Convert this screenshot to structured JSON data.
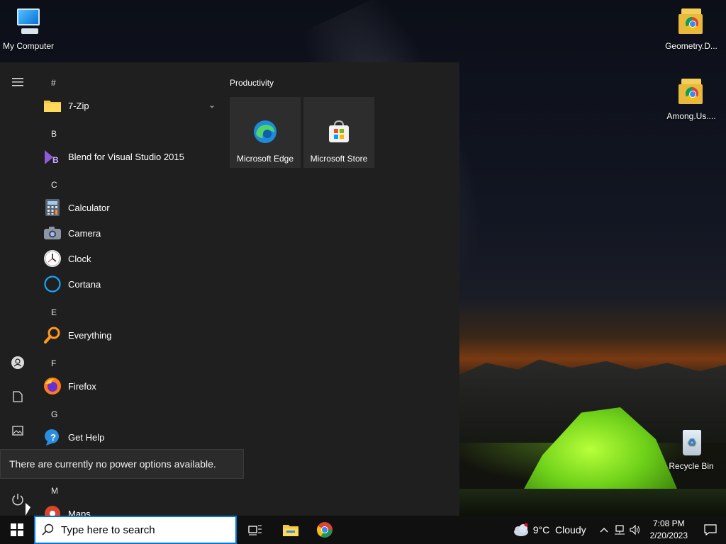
{
  "desktop": {
    "icons": [
      {
        "label": "My Computer"
      },
      {
        "label": "Geometry.D..."
      },
      {
        "label": "Among.Us...."
      },
      {
        "label": "Recycle Bin"
      }
    ]
  },
  "start_menu": {
    "groups": [
      {
        "letter": "#",
        "apps": [
          {
            "label": "7-Zip",
            "icon": "folder-icon",
            "expandable": true
          }
        ]
      },
      {
        "letter": "B",
        "apps": [
          {
            "label": "Blend for Visual Studio 2015",
            "icon": "blend-icon"
          }
        ]
      },
      {
        "letter": "C",
        "apps": [
          {
            "label": "Calculator",
            "icon": "calculator-icon"
          },
          {
            "label": "Camera",
            "icon": "camera-icon"
          },
          {
            "label": "Clock",
            "icon": "clock-icon"
          },
          {
            "label": "Cortana",
            "icon": "cortana-icon"
          }
        ]
      },
      {
        "letter": "E",
        "apps": [
          {
            "label": "Everything",
            "icon": "everything-icon"
          }
        ]
      },
      {
        "letter": "F",
        "apps": [
          {
            "label": "Firefox",
            "icon": "firefox-icon"
          }
        ]
      },
      {
        "letter": "G",
        "apps": [
          {
            "label": "Get Help",
            "icon": "get-help-icon"
          }
        ]
      },
      {
        "letter": "M",
        "apps": [
          {
            "label": "Maps",
            "icon": "maps-icon"
          }
        ]
      }
    ],
    "tiles_group_title": "Productivity",
    "tiles": [
      {
        "label": "Microsoft Edge",
        "icon": "edge-icon"
      },
      {
        "label": "Microsoft Store",
        "icon": "store-icon"
      }
    ],
    "power_tooltip": "There are currently no power options available."
  },
  "taskbar": {
    "search_placeholder": "Type here to search",
    "weather": "9°C  Cloudy",
    "time": "7:08 PM",
    "date": "2/20/2023"
  },
  "colors": {
    "accent": "#0078d7",
    "start_bg": "#1f1f1f",
    "tile_bg": "#2d2d2d",
    "taskbar_bg": "#101010"
  }
}
